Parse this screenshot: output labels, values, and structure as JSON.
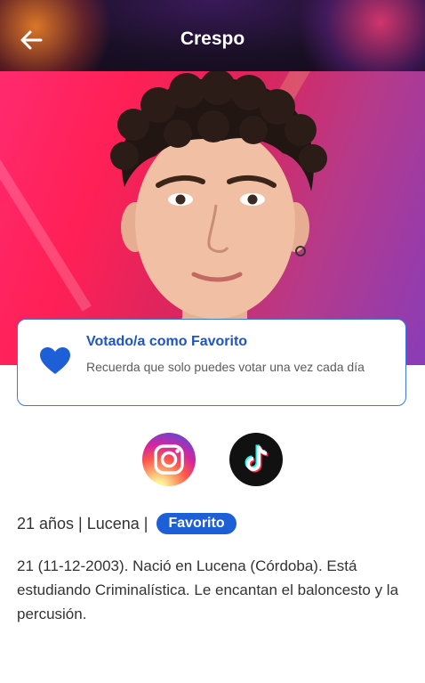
{
  "header": {
    "title": "Crespo",
    "back_icon": "arrow-left-icon"
  },
  "favorite_card": {
    "icon": "heart-icon",
    "title": "Votado/a como Favorito",
    "description": "Recuerda que solo puedes votar una vez cada día",
    "accent_color": "#1c55c8"
  },
  "socials": {
    "instagram_icon": "instagram-icon",
    "tiktok_icon": "tiktok-icon"
  },
  "profile": {
    "meta_text": "21 años | Lucena |",
    "badge": "Favorito",
    "bio": "21 (11-12-2003). Nació en Lucena (Córdoba). Está estudiando Criminalística. Le encantan el baloncesto y la percusión."
  }
}
